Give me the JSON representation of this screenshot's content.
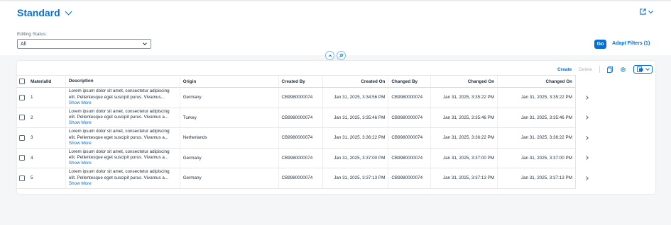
{
  "header": {
    "title": "Standard",
    "filter_label": "Editing Status:",
    "filter_value": "All",
    "go_label": "Go",
    "adapt_filters_label": "Adapt Filters (1)"
  },
  "toolbar": {
    "create_label": "Create",
    "delete_label": "Delete"
  },
  "table": {
    "columns": {
      "materialid": "MaterialId",
      "description": "Description",
      "origin": "Origin",
      "created_by": "Created By",
      "created_on": "Created On",
      "changed_by": "Changed By",
      "changed_on": "Changed On",
      "changed_on_2": "Changed On"
    },
    "rows": [
      {
        "id": "1",
        "desc": "Lorem ipsum dolor sit amet, consectetur adipiscing elit. Pellentesque eget suscipit purus.",
        "desc_tail": "Vivamus...",
        "show_more": "Show More",
        "origin": "Germany",
        "created_by": "CB9980000074",
        "created_on": "Jan 31, 2025, 3:34:56 PM",
        "changed_by": "CB9980000074",
        "changed_on": "Jan 31, 2025, 3:35:22 PM",
        "changed_on_2": "Jan 31, 2025, 3:35:22 PM"
      },
      {
        "id": "2",
        "desc": "Lorem ipsum dolor sit amet, consectetur adipiscing elit. Pellentesque eget suscipit purus.",
        "desc_tail": "Vivamus a...",
        "show_more": "Show More",
        "origin": "Turkey",
        "created_by": "CB9980000074",
        "created_on": "Jan 31, 2025, 3:35:46 PM",
        "changed_by": "CB9980000074",
        "changed_on": "Jan 31, 2025, 3:35:46 PM",
        "changed_on_2": "Jan 31, 2025, 3:35:46 PM"
      },
      {
        "id": "3",
        "desc": "Lorem ipsum dolor sit amet, consectetur adipiscing elit. Pellentesque eget suscipit purus.",
        "desc_tail": "Vivamus a...",
        "show_more": "Show More",
        "origin": "Netherlands",
        "created_by": "CB9980000074",
        "created_on": "Jan 31, 2025, 3:36:22 PM",
        "changed_by": "CB9980000074",
        "changed_on": "Jan 31, 2025, 3:36:22 PM",
        "changed_on_2": "Jan 31, 2025, 3:36:22 PM"
      },
      {
        "id": "4",
        "desc": "Lorem ipsum dolor sit amet, consectetur adipiscing elit. Pellentesque eget suscipit purus.",
        "desc_tail": "Vivamus a...",
        "show_more": "Show More",
        "origin": "Germany",
        "created_by": "CB9980000074",
        "created_on": "Jan 31, 2025, 3:37:00 PM",
        "changed_by": "CB9980000074",
        "changed_on": "Jan 31, 2025, 3:37:00 PM",
        "changed_on_2": "Jan 31, 2025, 3:37:00 PM"
      },
      {
        "id": "5",
        "desc": "Lorem ipsum dolor sit amet, consectetur adipiscing elit. Pellentesque eget suscipit purus.",
        "desc_tail": "Vivamus a...",
        "show_more": "Show More",
        "origin": "Germany",
        "created_by": "CB9980000074",
        "created_on": "Jan 31, 2025, 3:37:13 PM",
        "changed_by": "CB9980000074",
        "changed_on": "Jan 31, 2025, 3:37:13 PM",
        "changed_on_2": "Jan 31, 2025, 3:37:13 PM"
      }
    ]
  },
  "icons": {
    "title_menu": "chevron-down-icon",
    "share": "share-icon",
    "collapse_header": "chevron-up-icon",
    "pin_header": "pin-icon",
    "copy": "copy-icon",
    "settings": "gear-icon",
    "export": "export-icon",
    "row_nav": "chevron-right-icon"
  },
  "colors": {
    "accent": "#0a6ed1",
    "background": "#f5f6f7",
    "text": "#1d2d3e"
  }
}
